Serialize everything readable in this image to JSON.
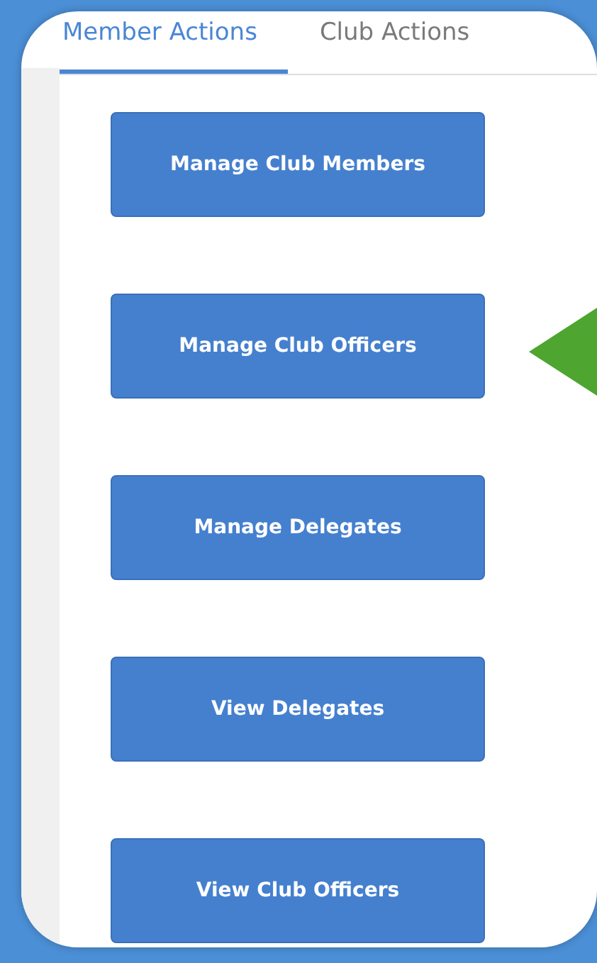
{
  "tabs": [
    {
      "label": "Member Actions",
      "selected": true
    },
    {
      "label": "Club Actions",
      "selected": false
    }
  ],
  "buttons": [
    {
      "label": "Manage Club Members"
    },
    {
      "label": "Manage Club Officers"
    },
    {
      "label": "Manage Delegates"
    },
    {
      "label": "View Delegates"
    },
    {
      "label": "View Club Officers"
    }
  ]
}
